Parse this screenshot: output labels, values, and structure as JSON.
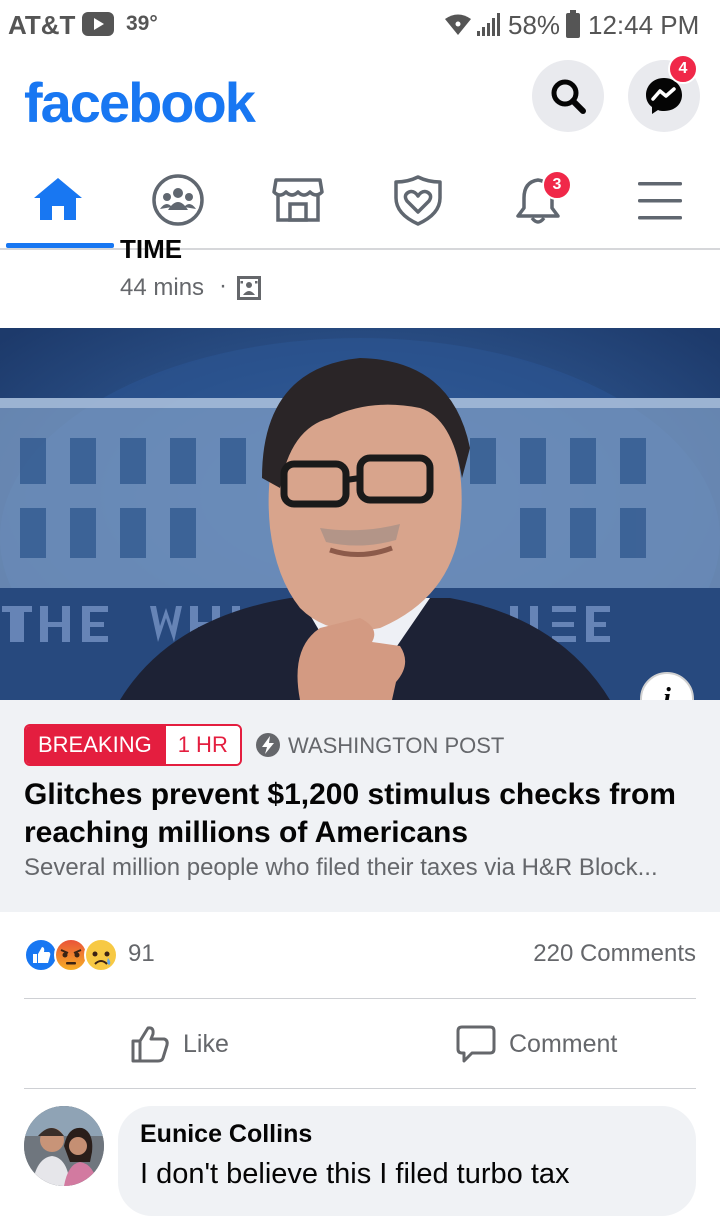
{
  "status_bar": {
    "carrier": "AT&T",
    "temperature": "39°",
    "battery": "58%",
    "time": "12:44 PM"
  },
  "top_bar": {
    "logo": "facebook",
    "messenger_badge": "4"
  },
  "nav": {
    "notifications_badge": "3"
  },
  "post": {
    "header_partial_text": "TIME",
    "time": "44 mins",
    "dot": "·"
  },
  "link": {
    "breaking_label": "BREAKING",
    "age_label": "1 HR",
    "source": "WASHINGTON POST",
    "headline": "Glitches prevent $1,200 stimulus checks from reaching millions of Americans",
    "snippet": "Several million people who filed their taxes via H&R Block..."
  },
  "reactions": {
    "count": "91",
    "comments": "220 Comments"
  },
  "actions": {
    "like_label": "Like",
    "comment_label": "Comment"
  },
  "top_comment": {
    "author": "Eunice Collins",
    "text": "I don't believe this I filed turbo tax"
  },
  "colors": {
    "brand_blue": "#1877f2",
    "breaking_red": "#e41e3f",
    "badge_red": "#f02849"
  }
}
